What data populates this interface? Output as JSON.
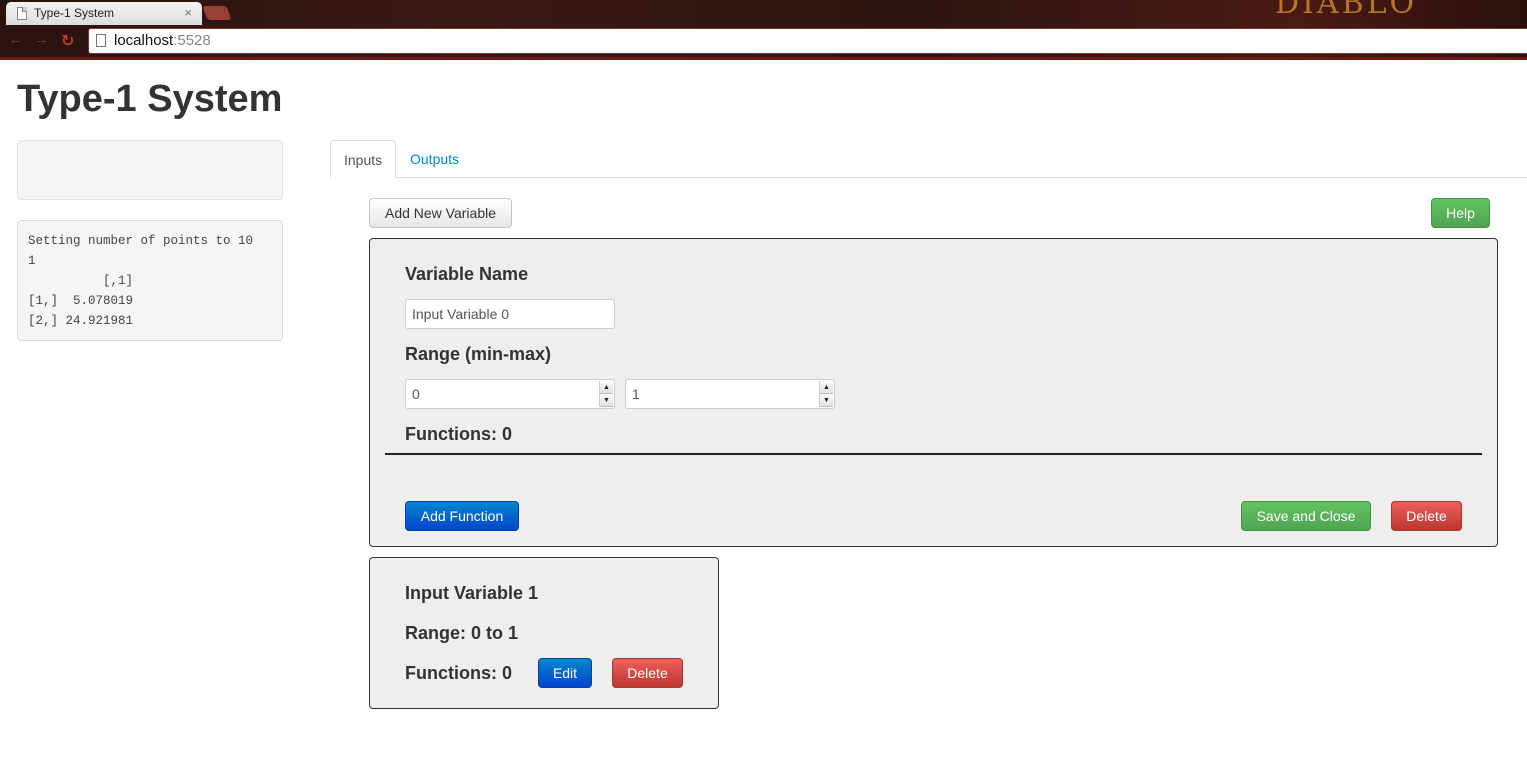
{
  "browser": {
    "tab_title": "Type-1 System",
    "tab_close": "×",
    "url_host": "localhost",
    "url_port": ":5528",
    "back": "←",
    "forward": "→",
    "reload": "↻",
    "logo": "DIABLO"
  },
  "page": {
    "title": "Type-1 System",
    "console_output": "Setting number of points to 10\n1\n          [,1]\n[1,]  5.078019\n[2,] 24.921981"
  },
  "tabs": [
    {
      "label": "Inputs",
      "active": true
    },
    {
      "label": "Outputs",
      "active": false
    }
  ],
  "toolbar": {
    "add_variable_label": "Add New Variable",
    "help_label": "Help"
  },
  "editor": {
    "variable_name_label": "Variable Name",
    "variable_name_value": "Input Variable 0",
    "range_label": "Range (min-max)",
    "range_min": "0",
    "range_max": "1",
    "functions_label": "Functions: 0",
    "add_function_label": "Add Function",
    "save_close_label": "Save and Close",
    "delete_label": "Delete"
  },
  "variable_card": {
    "name": "Input Variable 1",
    "range": "Range: 0 to 1",
    "functions": "Functions: 0",
    "edit_label": "Edit",
    "delete_label": "Delete"
  },
  "colors": {
    "success": "#5bb75b",
    "primary": "#0074cc",
    "danger": "#da4f49",
    "link": "#0088cc"
  }
}
